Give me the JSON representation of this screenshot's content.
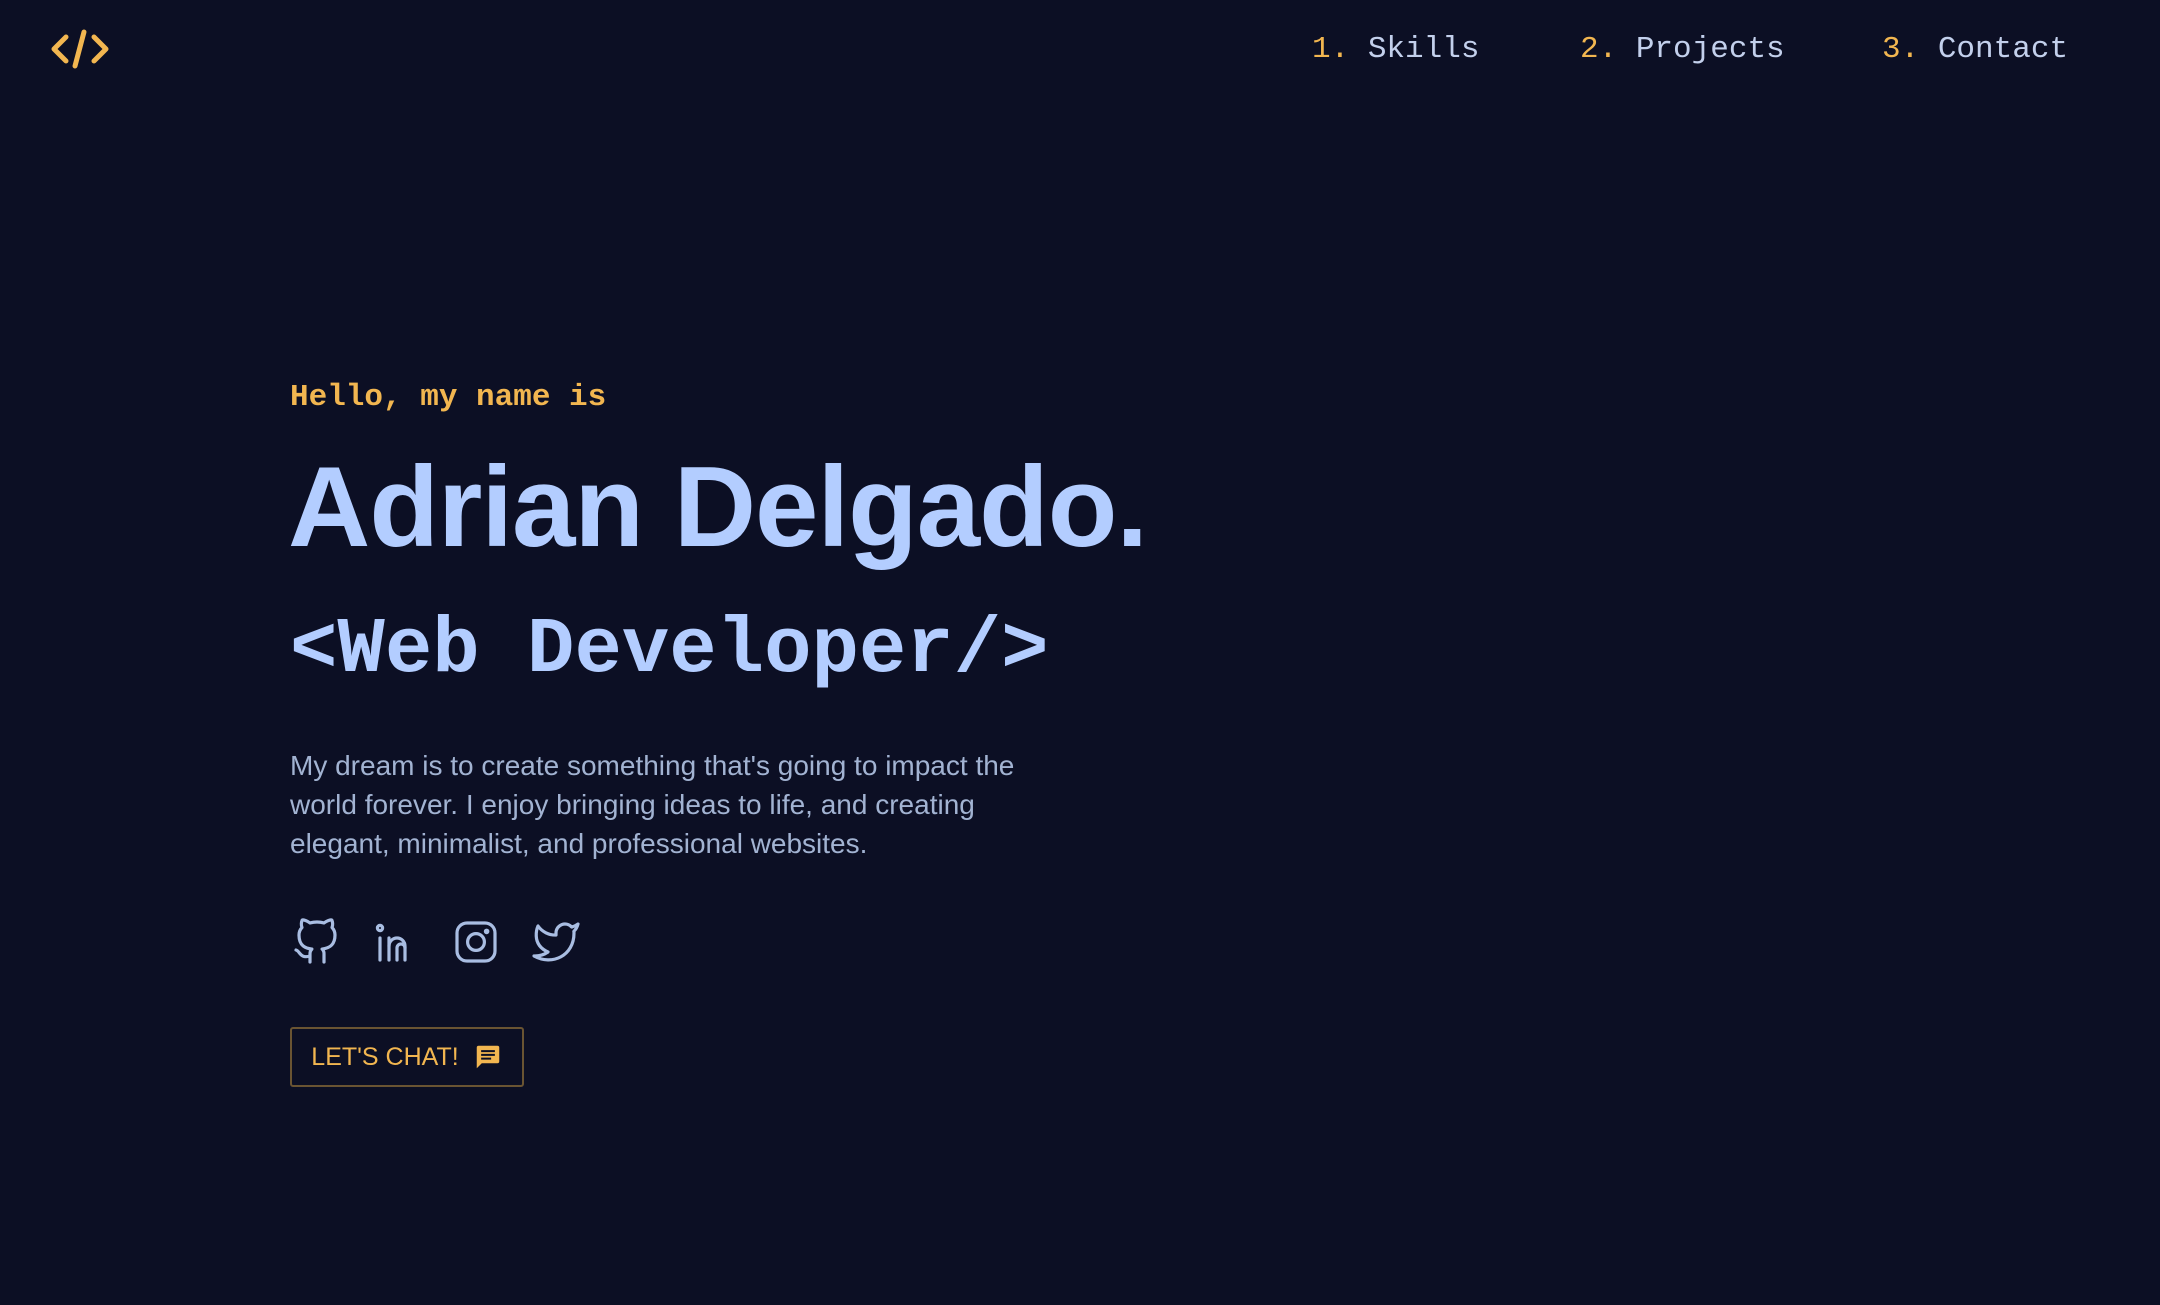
{
  "header": {
    "logo_icon": "code-icon",
    "nav": [
      {
        "number": "1.",
        "label": "Skills"
      },
      {
        "number": "2.",
        "label": "Projects"
      },
      {
        "number": "3.",
        "label": "Contact"
      }
    ]
  },
  "hero": {
    "greeting": "Hello, my name is",
    "name": "Adrian Delgado.",
    "role": "<Web Developer/>",
    "bio": "My dream is to create something that's going to impact the world forever. I enjoy bringing ideas to life, and creating elegant, minimalist, and professional websites.",
    "socials": [
      {
        "icon": "github-icon"
      },
      {
        "icon": "linkedin-icon"
      },
      {
        "icon": "instagram-icon"
      },
      {
        "icon": "twitter-icon"
      }
    ],
    "cta": {
      "label": "LET'S CHAT!",
      "icon": "chat-icon"
    }
  },
  "colors": {
    "background": "#0c0f24",
    "accent": "#f2b650",
    "heading": "#b3cdff",
    "text": "#a2b3d2",
    "nav_text": "#c3d0ec"
  }
}
